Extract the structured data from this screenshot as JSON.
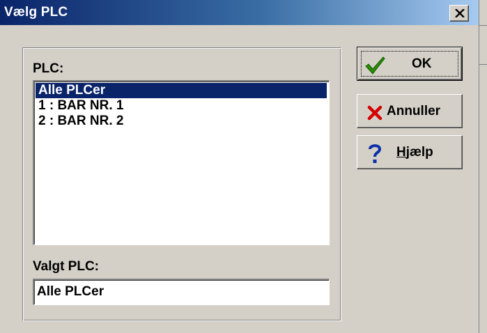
{
  "window": {
    "title": "Vælg PLC"
  },
  "plc_group": {
    "list_label": "PLC:",
    "items": [
      {
        "label": "Alle PLCer",
        "selected": true
      },
      {
        "label": "1 : BAR NR. 1",
        "selected": false
      },
      {
        "label": "2 : BAR NR. 2",
        "selected": false
      }
    ],
    "selected_label": "Valgt PLC:",
    "selected_value": "Alle PLCer"
  },
  "buttons": {
    "ok": {
      "label": "OK",
      "icon": "checkmark-icon",
      "color": "#008000"
    },
    "cancel": {
      "label": "Annuller",
      "icon": "red-x-icon",
      "color": "#cc0000"
    },
    "help": {
      "label_prefix": "",
      "label_mnemonic": "H",
      "label_rest": "jælp",
      "icon": "question-mark-icon",
      "color": "#0000aa"
    }
  },
  "colors": {
    "titlebar_start": "#0a246a",
    "titlebar_end": "#a6caf0",
    "selection": "#0a246a",
    "face": "#d4d0c8"
  }
}
